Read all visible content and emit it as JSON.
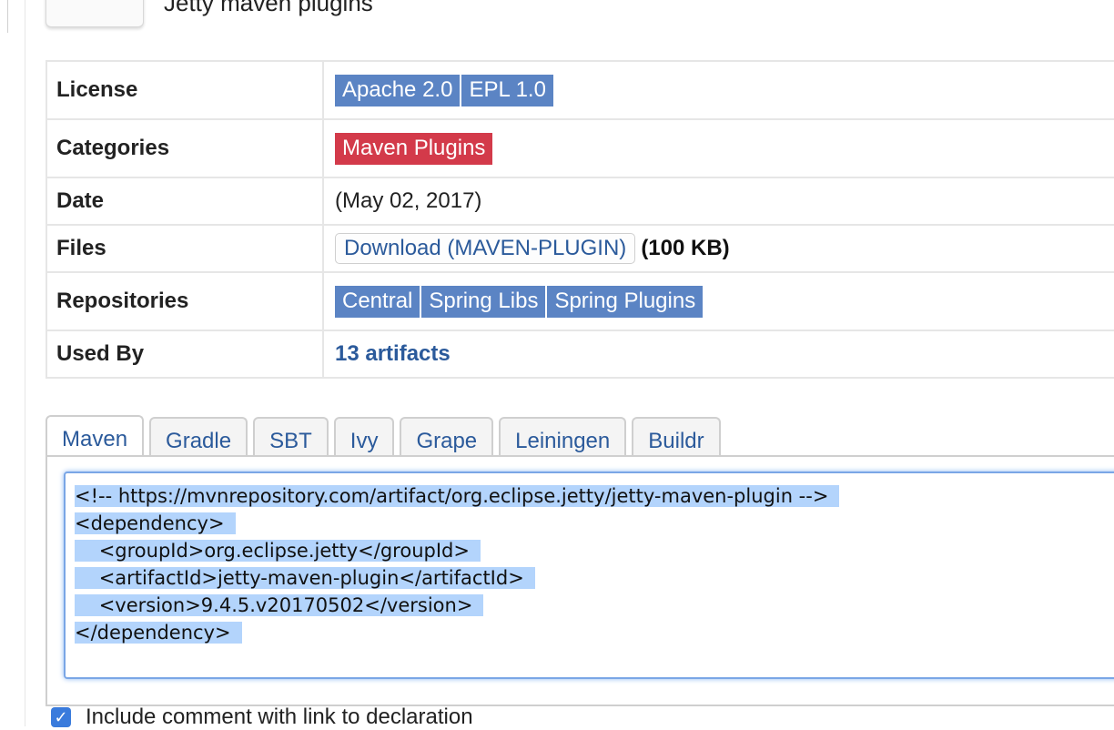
{
  "page": {
    "title": "Jetty maven plugins"
  },
  "info": {
    "rows": [
      {
        "label": "License"
      },
      {
        "label": "Categories"
      },
      {
        "label": "Date"
      },
      {
        "label": "Files"
      },
      {
        "label": "Repositories"
      },
      {
        "label": "Used By"
      }
    ],
    "licenses": [
      "Apache 2.0",
      "EPL 1.0"
    ],
    "categories": [
      "Maven Plugins"
    ],
    "date": "(May 02, 2017)",
    "download_label": "Download (MAVEN-PLUGIN)",
    "file_size": "(100 KB)",
    "repositories": [
      "Central",
      "Spring Libs",
      "Spring Plugins"
    ],
    "used_by": "13 artifacts"
  },
  "tabs": [
    "Maven",
    "Gradle",
    "SBT",
    "Ivy",
    "Grape",
    "Leiningen",
    "Buildr"
  ],
  "active_tab": "Maven",
  "code": {
    "lines": [
      "<!-- https://mvnrepository.com/artifact/org.eclipse.jetty/jetty-maven-plugin -->",
      "<dependency>",
      "    <groupId>org.eclipse.jetty</groupId>",
      "    <artifactId>jetty-maven-plugin</artifactId>",
      "    <version>9.4.5.v20170502</version>",
      "</dependency>"
    ]
  },
  "include_comment": {
    "checked": true,
    "label": "Include comment with link to declaration"
  },
  "colors": {
    "tag_blue": "#5b84c4",
    "tag_red": "#d33a4a",
    "link": "#2b5a9b",
    "selection": "#b3d4fc"
  }
}
